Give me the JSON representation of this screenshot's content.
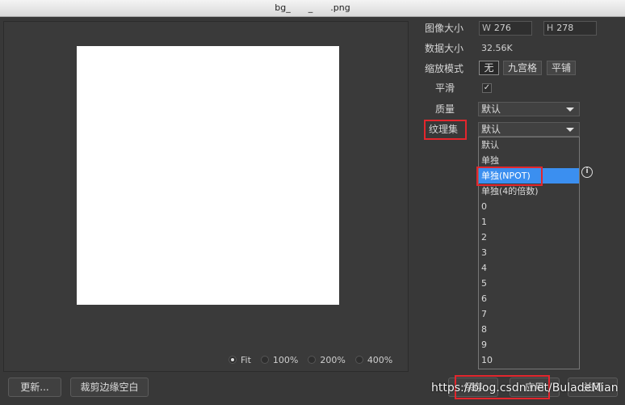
{
  "window": {
    "title": "bg_  _  .png"
  },
  "preview": {
    "zoom_options": [
      "Fit",
      "100%",
      "200%",
      "400%"
    ],
    "zoom_selected": "Fit"
  },
  "props": {
    "image_size_label": "图像大小",
    "width_prefix": "W",
    "width_value": "276",
    "height_prefix": "H",
    "height_value": "278",
    "data_size_label": "数据大小",
    "data_size_value": "32.56K",
    "scale_mode_label": "缩放模式",
    "scale_modes": [
      "无",
      "九宫格",
      "平铺"
    ],
    "scale_mode_selected": "无",
    "smooth_label": "平滑",
    "smooth_checked": "✓",
    "quality_label": "质量",
    "quality_value": "默认",
    "atlas_label": "纹理集",
    "atlas_value": "默认"
  },
  "atlas_options": [
    "默认",
    "单独",
    "单独(NPOT)",
    "单独(4的倍数)",
    "0",
    "1",
    "2",
    "3",
    "4",
    "5",
    "6",
    "7",
    "8",
    "9",
    "10"
  ],
  "atlas_highlighted": "单独(NPOT)",
  "info_icon": "i",
  "buttons": {
    "update": "更新...",
    "crop": "裁剪边缘空白",
    "save": "保存",
    "apply": "应用",
    "close": "关闭"
  },
  "watermark": "https://blog.csdn.net/BuladeMian",
  "colors": {
    "highlight": "#3b8ff0",
    "annotation": "#e3262d"
  }
}
